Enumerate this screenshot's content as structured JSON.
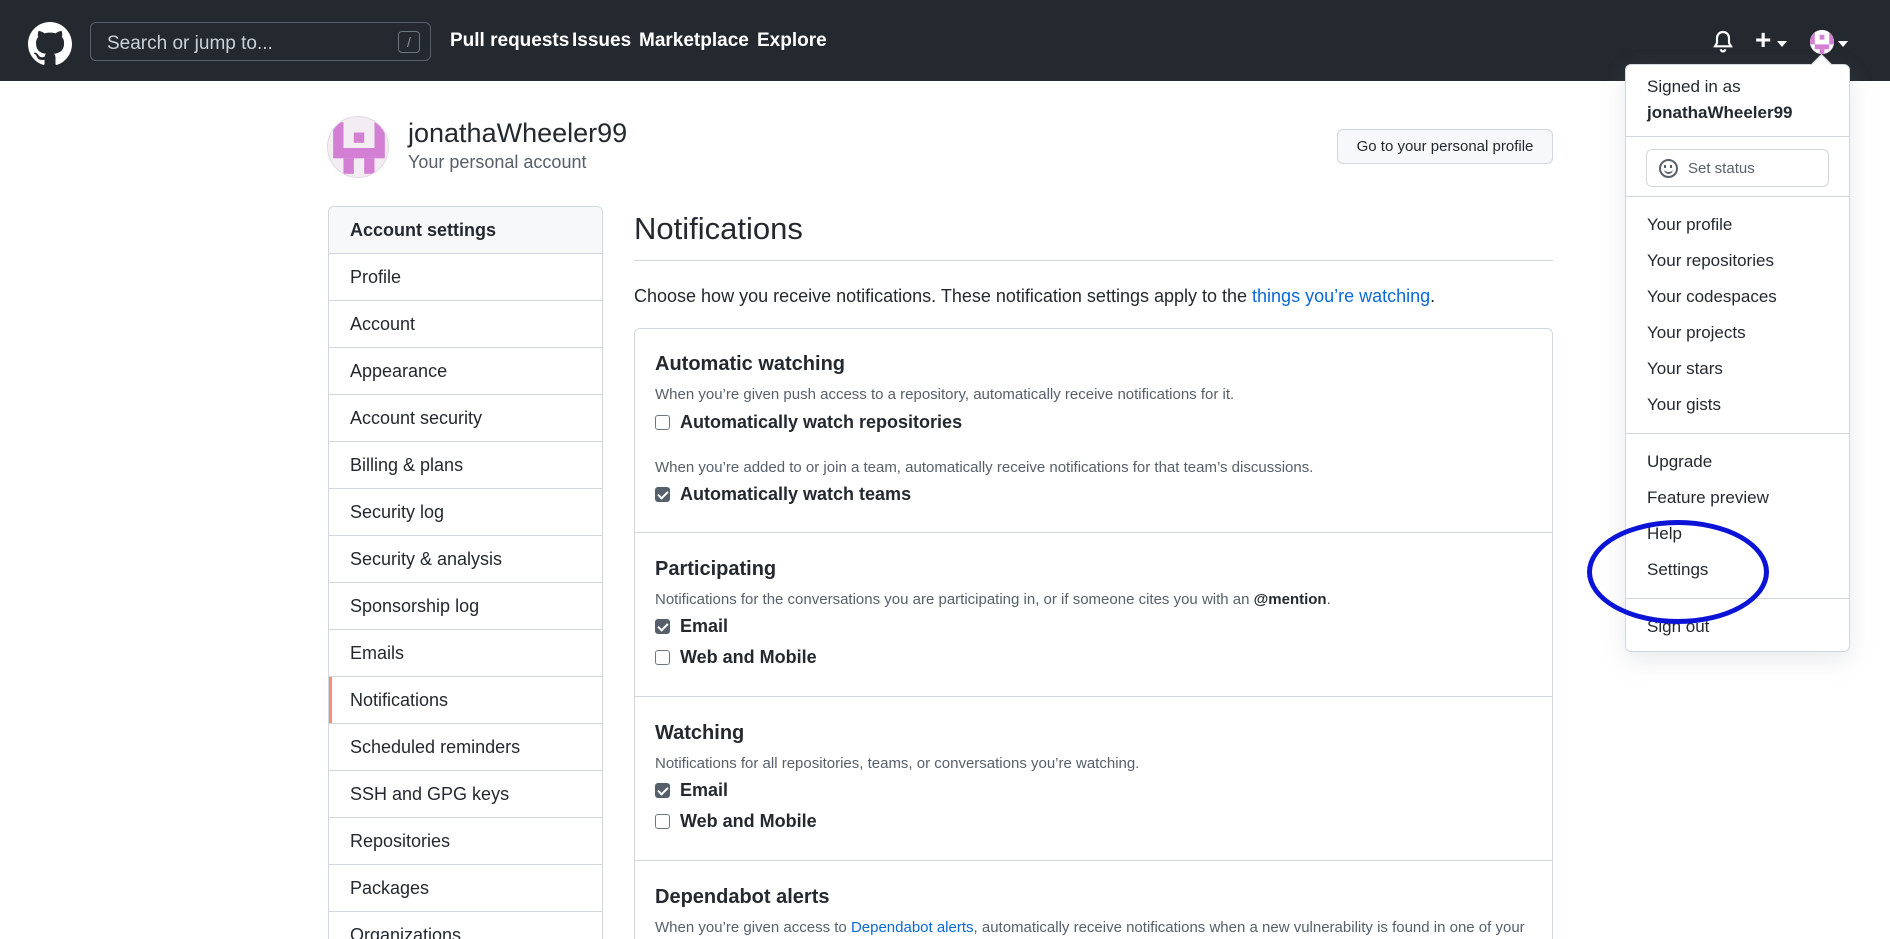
{
  "header": {
    "search_placeholder": "Search or jump to...",
    "search_shortcut": "/",
    "nav": [
      "Pull requests",
      "Issues",
      "Marketplace",
      "Explore"
    ],
    "plus_label": "+"
  },
  "account": {
    "username": "jonathaWheeler99",
    "subtitle": "Your personal account",
    "profile_button": "Go to your personal profile"
  },
  "sidebar": {
    "heading": "Account settings",
    "items": [
      {
        "label": "Profile"
      },
      {
        "label": "Account"
      },
      {
        "label": "Appearance"
      },
      {
        "label": "Account security"
      },
      {
        "label": "Billing & plans"
      },
      {
        "label": "Security log"
      },
      {
        "label": "Security & analysis"
      },
      {
        "label": "Sponsorship log"
      },
      {
        "label": "Emails"
      },
      {
        "label": "Notifications",
        "active": true
      },
      {
        "label": "Scheduled reminders"
      },
      {
        "label": "SSH and GPG keys"
      },
      {
        "label": "Repositories"
      },
      {
        "label": "Packages"
      },
      {
        "label": "Organizations"
      }
    ]
  },
  "main": {
    "title": "Notifications",
    "intro_text": "Choose how you receive notifications. These notification settings apply to the ",
    "intro_link": "things you’re watching",
    "intro_end": ".",
    "sections": {
      "automatic": {
        "title": "Automatic watching",
        "desc1": "When you’re given push access to a repository, automatically receive notifications for it.",
        "cb1": {
          "label": "Automatically watch repositories",
          "checked": false
        },
        "desc2": "When you’re added to or join a team, automatically receive notifications for that team’s discussions.",
        "cb2": {
          "label": "Automatically watch teams",
          "checked": true
        }
      },
      "participating": {
        "title": "Participating",
        "desc_pre": "Notifications for the conversations you are participating in, or if someone cites you with an ",
        "desc_mention": "@mention",
        "desc_post": ".",
        "email": {
          "label": "Email",
          "checked": true
        },
        "web": {
          "label": "Web and Mobile",
          "checked": false
        }
      },
      "watching": {
        "title": "Watching",
        "desc": "Notifications for all repositories, teams, or conversations you’re watching.",
        "email": {
          "label": "Email",
          "checked": true
        },
        "web": {
          "label": "Web and Mobile",
          "checked": false
        }
      },
      "dependabot": {
        "title": "Dependabot alerts",
        "desc_pre": "When you’re given access to ",
        "desc_link": "Dependabot alerts",
        "desc_post": ", automatically receive notifications when a new vulnerability is found in one of your"
      }
    }
  },
  "dropdown": {
    "signed_in_as": "Signed in as",
    "username": "jonathaWheeler99",
    "set_status": "Set status",
    "group1": [
      "Your profile",
      "Your repositories",
      "Your codespaces",
      "Your projects",
      "Your stars",
      "Your gists"
    ],
    "group2": [
      "Upgrade",
      "Feature preview",
      "Help",
      "Settings"
    ],
    "sign_out": "Sign out"
  },
  "colors": {
    "header_bg": "#24292f",
    "link": "#0969da",
    "active_marker": "#fd8c73",
    "annotation": "#0b14d6",
    "avatar_accent": "#d37fd3"
  },
  "icons": [
    "github-logo-icon",
    "bell-icon",
    "plus-icon",
    "chevron-down-icon",
    "smiley-icon"
  ]
}
